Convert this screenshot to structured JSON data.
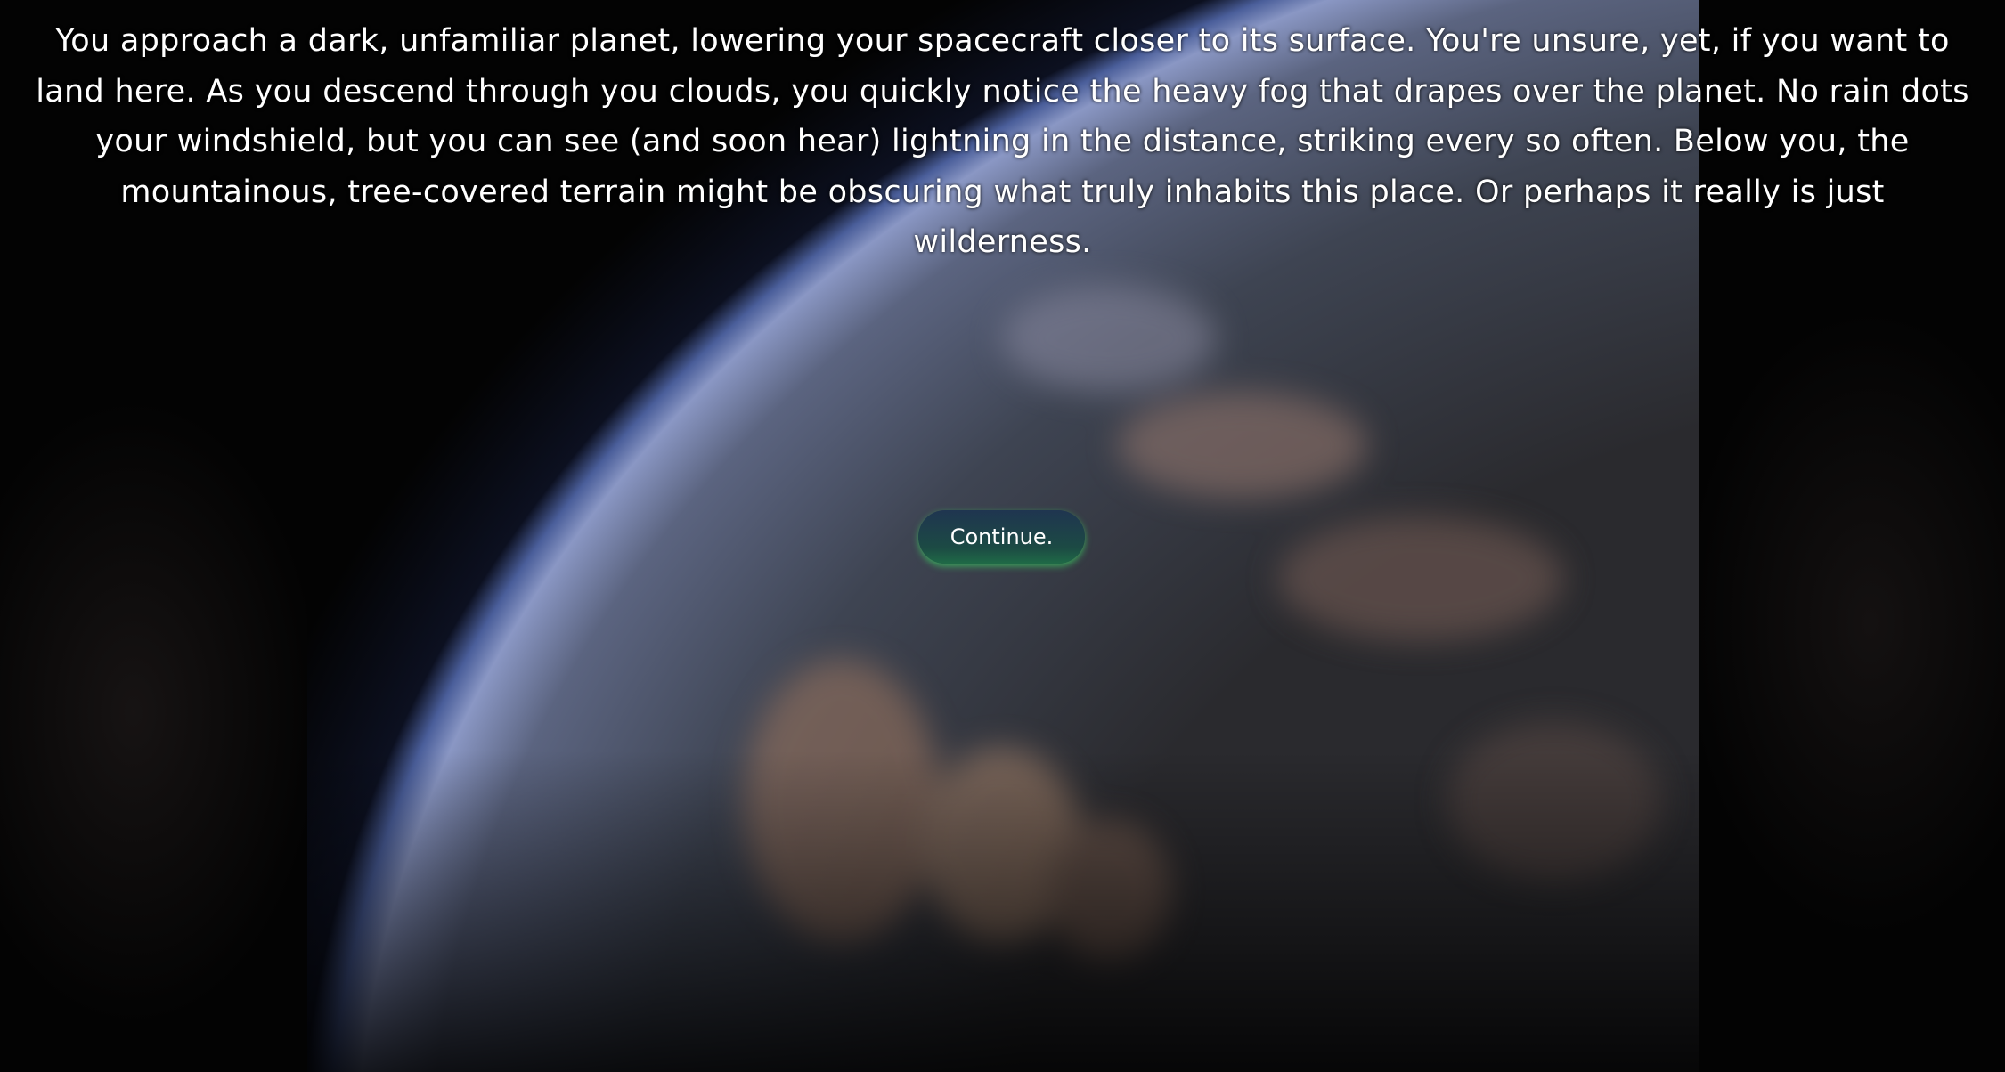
{
  "story": {
    "text": "You approach a dark, unfamiliar planet, lowering your spacecraft closer to its surface. You're unsure, yet, if you want to land here. As you descend through you clouds, you quickly notice the heavy fog that drapes over the planet. No rain dots your windshield, but you can see (and soon hear) lightning in the distance, striking every so often. Below you, the mountainous, tree-covered terrain might be obscuring what truly inhabits this place. Or perhaps it really is just wilderness."
  },
  "actions": {
    "continue_label": "Continue."
  },
  "colors": {
    "button_top": "#1f3550",
    "button_glow": "#3cd264",
    "text": "#ffffff"
  }
}
